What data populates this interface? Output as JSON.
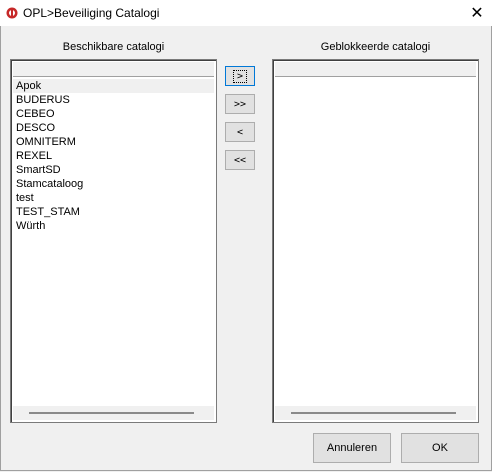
{
  "window": {
    "title": "OPL>Beveiliging Catalogi",
    "close_glyph": "✕"
  },
  "left_panel": {
    "label": "Beschikbare catalogi",
    "selected_item": "Apok",
    "items": [
      "Apok",
      "BUDERUS",
      "CEBEO",
      "DESCO",
      "OMNITERM",
      "REXEL",
      "SmartSD",
      "Stamcataloog",
      "test",
      "TEST_STAM",
      "Würth"
    ]
  },
  "right_panel": {
    "label": "Geblokkeerde catalogi",
    "items": []
  },
  "move_buttons": {
    "move_right": ">",
    "move_all_right": ">>",
    "move_left": "<",
    "move_all_left": "<<"
  },
  "footer": {
    "cancel_label": "Annuleren",
    "ok_label": "OK"
  },
  "icons": {
    "app": "app-icon",
    "close": "close-icon"
  }
}
